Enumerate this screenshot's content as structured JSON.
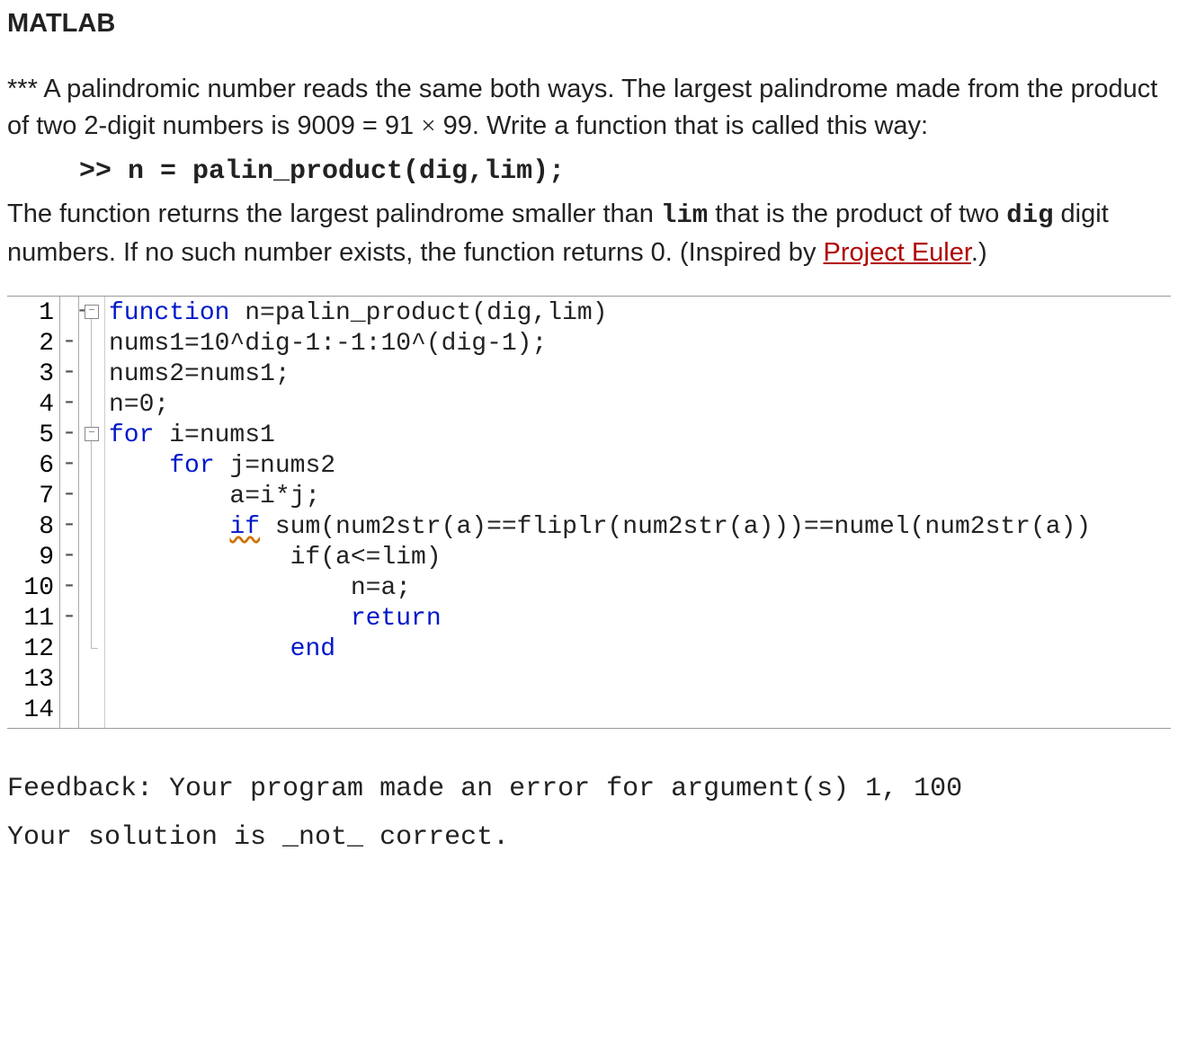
{
  "heading": "MATLAB",
  "problem": {
    "stars": "***",
    "intro_a": " A palindromic number reads the same both ways. The largest palindrome made from the product of two 2-digit numbers is 9009 = 91 ",
    "times": "×",
    "intro_b": " 99. Write a function that is called this way:",
    "call_line": ">> n = palin_product(dig,lim);",
    "desc_a": "The function returns the largest palindrome smaller than ",
    "lim": "lim",
    "desc_b": " that is the product of two ",
    "dig": "dig",
    "desc_c": " digit numbers. If no such number exists, the function returns 0. (Inspired by ",
    "link_text": "Project Euler",
    "desc_d": ".)"
  },
  "code": {
    "lines": [
      {
        "num": "1",
        "bp": "",
        "l": {
          "kw": "function",
          "rest": " n=palin_product(dig,lim)"
        }
      },
      {
        "num": "2",
        "bp": "-",
        "l": {
          "txt": "nums1=10^dig-1:-1:10^(dig-1);"
        }
      },
      {
        "num": "3",
        "bp": "-",
        "l": {
          "txt": "nums2=nums1;"
        }
      },
      {
        "num": "4",
        "bp": "-",
        "l": {
          "txt": "n=0;"
        }
      },
      {
        "num": "5",
        "bp": "-",
        "l": {
          "kw": "for",
          "rest": " i=nums1"
        }
      },
      {
        "num": "6",
        "bp": "-",
        "l": {
          "ind": "    ",
          "kw": "for",
          "rest": " j=nums2"
        }
      },
      {
        "num": "7",
        "bp": "-",
        "l": {
          "ind": "        ",
          "txt": "a=i*j;"
        }
      },
      {
        "num": "8",
        "bp": "-",
        "l": {
          "ind": "        ",
          "kw_sq": "if",
          "rest": " sum(num2str(a)==fliplr(num2str(a)))==numel(num2str(a))"
        }
      },
      {
        "num": "9",
        "bp": "-",
        "l": {
          "ind": "            ",
          "txt": "if(a<=lim)"
        }
      },
      {
        "num": "10",
        "bp": "-",
        "l": {
          "ind": "                ",
          "txt": "n=a;"
        }
      },
      {
        "num": "11",
        "bp": "-",
        "l": {
          "ind": "                ",
          "kw": "return",
          "rest": ""
        }
      },
      {
        "num": "12",
        "bp": "-",
        "l": {
          "ind": "            ",
          "kw": "end",
          "rest": ""
        }
      },
      {
        "num": "13",
        "bp": "",
        "l": {
          "txt": ""
        }
      },
      {
        "num": "14",
        "bp": "",
        "l": {
          "txt": ""
        }
      }
    ]
  },
  "feedback": {
    "line1": "Feedback: Your program made an error for argument(s) 1, 100",
    "line2": "Your solution is _not_ correct."
  }
}
